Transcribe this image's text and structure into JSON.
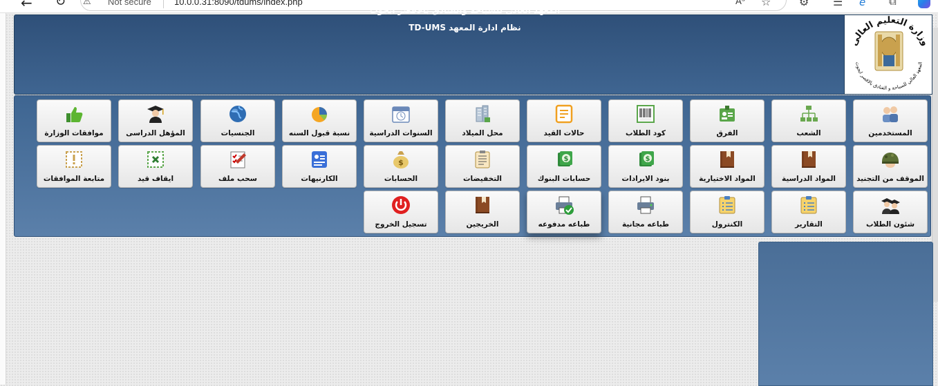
{
  "browser": {
    "not_secure": "Not secure",
    "url": "10.0.0.31:8090/tdums/index.php",
    "read_aloud": "Aᵃ"
  },
  "header": {
    "title_line1": "المعهد العالى للسياحة والفنادق بالاقصر ايجوث",
    "title_line2": "نظام ادارة المعهد TD-UMS",
    "logo_text_top": "وزارة التعليم العالى",
    "logo_text_bottom": "المعهد العالي للسياحة و الفنادق بالاقصر ايجوث"
  },
  "menu": {
    "row1": [
      {
        "label": "المستخدمين",
        "icon": "users-icon"
      },
      {
        "label": "الشعب",
        "icon": "org-chart-icon"
      },
      {
        "label": "الفرق",
        "icon": "id-badge-icon"
      },
      {
        "label": "كود الطلاب",
        "icon": "barcode-icon"
      },
      {
        "label": "حالات القيد",
        "icon": "note-icon"
      },
      {
        "label": "محل الميلاد",
        "icon": "building-icon"
      },
      {
        "label": "السنوات الدراسية",
        "icon": "calendar-icon"
      },
      {
        "label": "نسبة قبول السنه",
        "icon": "pie-chart-icon"
      },
      {
        "label": "الجنسيات",
        "icon": "globe-icon"
      },
      {
        "label": "المؤهل الدراسى",
        "icon": "graduate-icon"
      },
      {
        "label": "موافقات الوزارة",
        "icon": "thumbs-up-icon"
      }
    ],
    "row2": [
      {
        "label": "الموقف من التجنيد",
        "icon": "helmet-icon"
      },
      {
        "label": "المواد الدراسية",
        "icon": "book-icon"
      },
      {
        "label": "المواد الاختيارية",
        "icon": "book-icon"
      },
      {
        "label": "بنود الايرادات",
        "icon": "dollar-stack-icon"
      },
      {
        "label": "حسابات البنوك",
        "icon": "dollar-stack-icon"
      },
      {
        "label": "التخفيضات",
        "icon": "clipboard-icon"
      },
      {
        "label": "الحسابات",
        "icon": "money-bag-icon"
      },
      {
        "label": "الكارنيهات",
        "icon": "contact-card-icon"
      },
      {
        "label": "سحب ملف",
        "icon": "checklist-icon"
      },
      {
        "label": "ايقاف قيد",
        "icon": "stop-x-icon"
      },
      {
        "label": "متابعة الموافقات",
        "icon": "exclamation-icon"
      }
    ],
    "row3": [
      {
        "label": "شئون الطلاب",
        "icon": "students-icon"
      },
      {
        "label": "التقارير",
        "icon": "report-icon"
      },
      {
        "label": "الكنترول",
        "icon": "report-icon"
      },
      {
        "label": "طباعه مجانية",
        "icon": "printer-icon"
      },
      {
        "label": "طباعه مدفوعه",
        "icon": "printer-check-icon"
      },
      {
        "label": "الخريجين",
        "icon": "book-icon"
      },
      {
        "label": "تسجيل الخروج",
        "icon": "power-icon"
      }
    ]
  },
  "colors": {
    "header_bg": "#2f5079",
    "panel_bg": "#4a6e97",
    "tile_bg": "#f2f2f2"
  }
}
